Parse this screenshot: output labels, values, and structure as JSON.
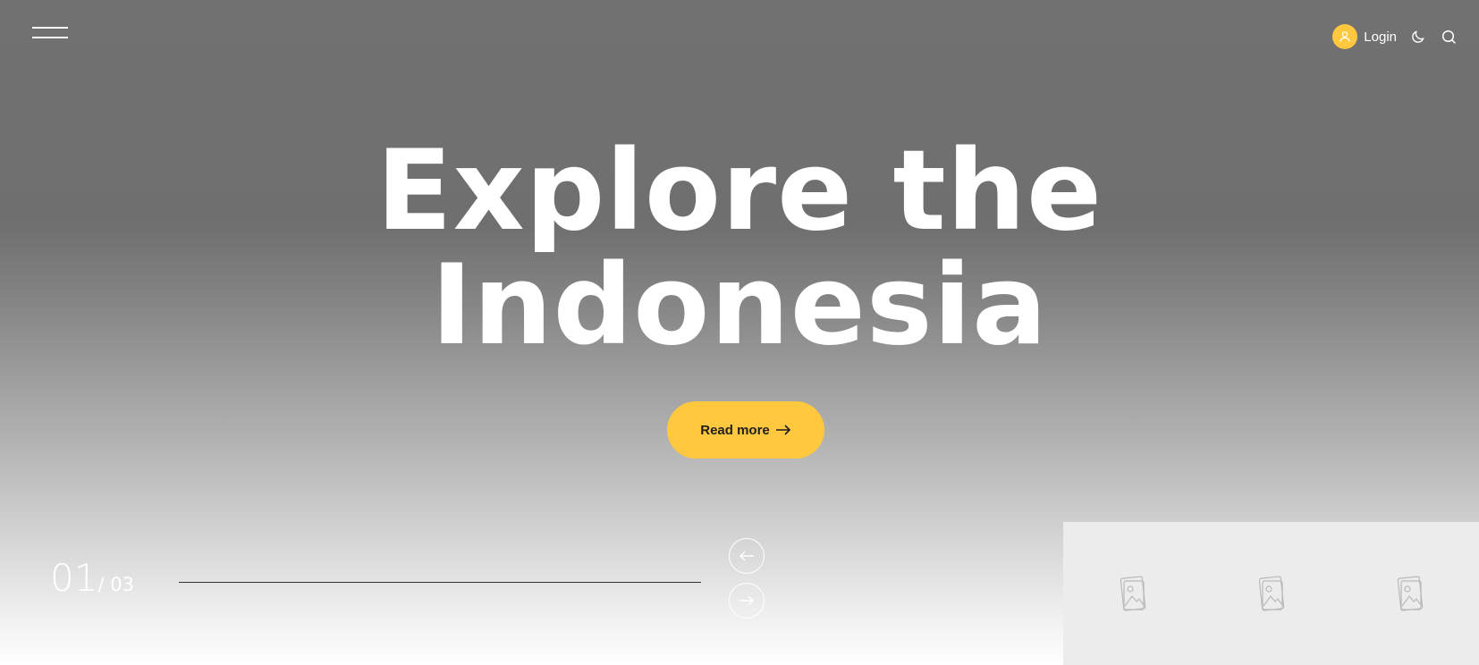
{
  "header": {
    "menu_icon": "hamburger-icon",
    "login_label": "Login",
    "user_icon": "user-icon",
    "theme_icon": "moon-icon",
    "search_icon": "search-icon"
  },
  "hero": {
    "title_line1": "Explore the",
    "title_line2": "Indonesia",
    "cta_label": "Read more",
    "cta_icon": "arrow-right-icon"
  },
  "slider": {
    "current": "01",
    "total": "/ 03",
    "prev_icon": "arrow-left-icon",
    "next_icon": "arrow-right-icon",
    "thumbnails": [
      {
        "icon": "image-placeholder-icon"
      },
      {
        "icon": "image-placeholder-icon"
      },
      {
        "icon": "image-placeholder-icon"
      }
    ]
  },
  "colors": {
    "accent": "#ffc83e",
    "text": "#ffffff",
    "cta_text": "#1e1e1e"
  }
}
